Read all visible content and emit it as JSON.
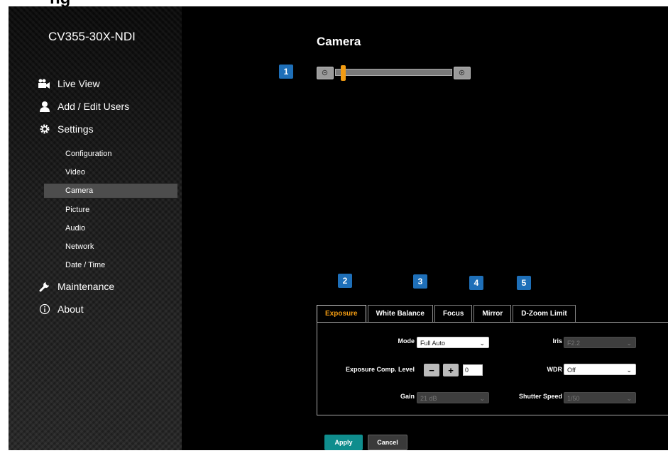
{
  "page": {
    "header_fragment": "ng"
  },
  "sidebar": {
    "device_name": "CV355-30X-NDI",
    "menu": [
      {
        "label": "Live View",
        "icon": "video-camera-icon"
      },
      {
        "label": "Add / Edit Users",
        "icon": "user-icon"
      },
      {
        "label": "Settings",
        "icon": "gear-icon"
      },
      {
        "label": "Maintenance",
        "icon": "wrench-icon"
      },
      {
        "label": "About",
        "icon": "info-icon"
      }
    ],
    "settings_sub": [
      {
        "label": "Configuration"
      },
      {
        "label": "Video"
      },
      {
        "label": "Camera",
        "active": true
      },
      {
        "label": "Picture"
      },
      {
        "label": "Audio"
      },
      {
        "label": "Network"
      },
      {
        "label": "Date / Time"
      }
    ]
  },
  "main": {
    "title": "Camera",
    "zoom": {
      "position_fraction": 0.05
    },
    "badges": [
      "1",
      "2",
      "3",
      "4",
      "5"
    ],
    "tabs": [
      {
        "label": "Exposure",
        "active": true
      },
      {
        "label": "White Balance"
      },
      {
        "label": "Focus"
      },
      {
        "label": "Mirror"
      },
      {
        "label": "D-Zoom Limit"
      }
    ],
    "exposure": {
      "mode_label": "Mode",
      "mode_value": "Full Auto",
      "iris_label": "Iris",
      "iris_value": "F2.2",
      "exp_comp_label": "Exposure Comp. Level",
      "exp_comp_minus": "−",
      "exp_comp_plus": "+",
      "exp_comp_value": "0",
      "wdr_label": "WDR",
      "wdr_value": "Off",
      "gain_label": "Gain",
      "gain_value": "21 dB",
      "shutter_label": "Shutter Speed",
      "shutter_value": "1/50"
    },
    "buttons": {
      "apply": "Apply",
      "cancel": "Cancel"
    }
  },
  "colors": {
    "accent": "#f39c12",
    "badge": "#1e6fb8",
    "apply": "#0f8d8d"
  }
}
